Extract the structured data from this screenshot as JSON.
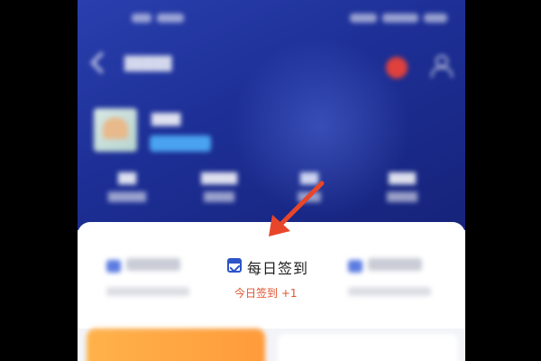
{
  "checkin": {
    "title": "每日签到",
    "subtitle": "今日签到 +1"
  },
  "colors": {
    "header_gradient_start": "#2a3fae",
    "header_gradient_end": "#16237a",
    "accent_blue": "#2d54c8",
    "subtitle_red": "#e0532f",
    "annotation_arrow": "#e8462a",
    "orange_button": "#ffa640"
  },
  "icons": {
    "back": "back-arrow-icon",
    "notification": "notification-icon",
    "user": "user-icon",
    "checkin": "calendar-check-icon"
  }
}
